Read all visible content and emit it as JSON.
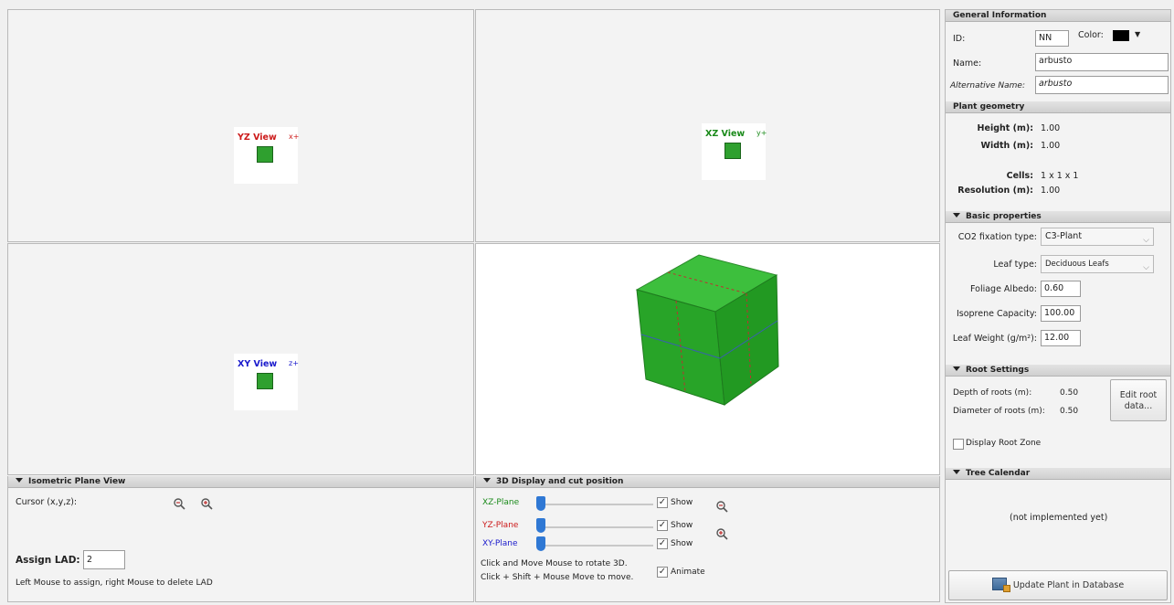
{
  "views": {
    "yz": {
      "label": "YZ View",
      "axis": "x+",
      "color": "#cc1a1a"
    },
    "xz": {
      "label": "XZ View",
      "axis": "y+",
      "color": "#1a8a1a"
    },
    "xy": {
      "label": "XY View",
      "axis": "z+",
      "color": "#1a1acc"
    }
  },
  "iso_panel": {
    "title": "Isometric Plane View",
    "cursor_label": "Cursor (x,y,z):",
    "assign_lad_label": "Assign LAD:",
    "assign_lad_value": "2",
    "hint": "Left Mouse to assign, right Mouse to delete LAD"
  },
  "display_panel": {
    "title": "3D Display and cut position",
    "planes": [
      {
        "label": "XZ-Plane",
        "color": "#1a8a1a",
        "show_label": "Show",
        "checked": true
      },
      {
        "label": "YZ-Plane",
        "color": "#cc1a1a",
        "show_label": "Show",
        "checked": true
      },
      {
        "label": "XY-Plane",
        "color": "#1a1acc",
        "show_label": "Show",
        "checked": true
      }
    ],
    "hint_line1": "Click and Move Mouse to rotate 3D.",
    "hint_line2": "Click + Shift + Mouse Move to move.",
    "animate_label": "Animate",
    "animate_checked": true
  },
  "general": {
    "title": "General Information",
    "id_label": "ID:",
    "id_value": "NN",
    "color_label": "Color:",
    "color_value": "#000000",
    "name_label": "Name:",
    "name_value": "arbusto",
    "alt_name_label": "Alternative Name:",
    "alt_name_value": "arbusto"
  },
  "geometry": {
    "title": "Plant geometry",
    "height_label": "Height (m):",
    "height_value": "1.00",
    "width_label": "Width (m):",
    "width_value": "1.00",
    "cells_label": "Cells:",
    "cells_value": "1 x 1 x 1",
    "resolution_label": "Resolution (m):",
    "resolution_value": "1.00"
  },
  "basic": {
    "title": "Basic properties",
    "co2_label": "CO2 fixation type:",
    "co2_value": "C3-Plant",
    "leaf_type_label": "Leaf type:",
    "leaf_type_value": "Deciduous Leafs",
    "albedo_label": "Foliage Albedo:",
    "albedo_value": "0.60",
    "isoprene_label": "Isoprene Capacity:",
    "isoprene_value": "100.00",
    "leaf_weight_label": "Leaf Weight (g/m²):",
    "leaf_weight_value": "12.00"
  },
  "root": {
    "title": "Root Settings",
    "depth_label": "Depth of roots (m):",
    "depth_value": "0.50",
    "diameter_label": "Diameter of roots (m):",
    "diameter_value": "0.50",
    "edit_button_line1": "Edit root",
    "edit_button_line2": "data...",
    "display_zone_label": "Display Root Zone",
    "display_zone_checked": false
  },
  "calendar": {
    "title": "Tree Calendar",
    "placeholder": "(not implemented yet)"
  },
  "update_button": "Update Plant in Database"
}
